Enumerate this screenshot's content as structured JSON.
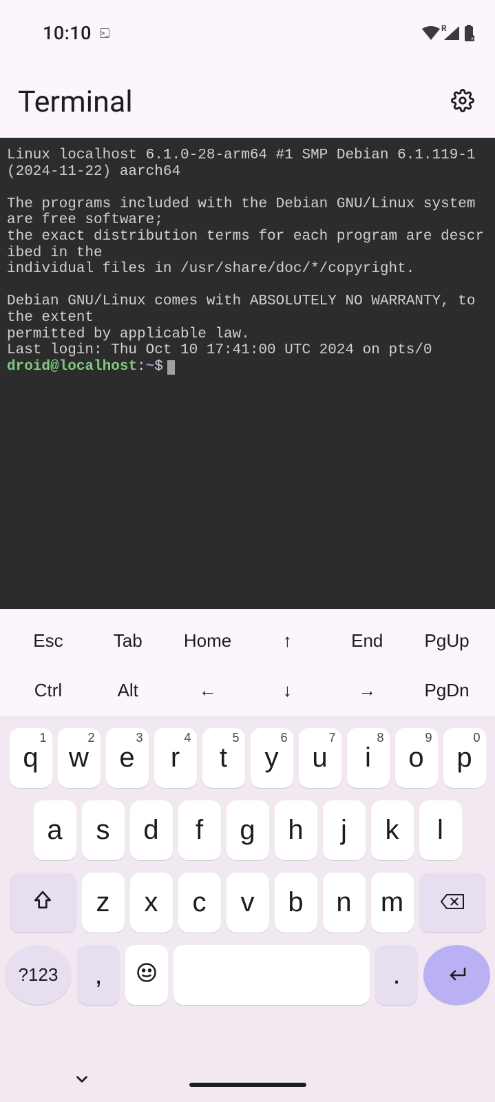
{
  "status": {
    "time": "10:10",
    "network_label": "R"
  },
  "header": {
    "title": "Terminal"
  },
  "terminal": {
    "motd_line1": "Linux localhost 6.1.0-28-arm64 #1 SMP Debian 6.1.119-1 (2024-11-22) aarch64",
    "blank1": "",
    "motd_line2": "The programs included with the Debian GNU/Linux system are free software;",
    "motd_line3": "the exact distribution terms for each program are described in the",
    "motd_line4": "individual files in /usr/share/doc/*/copyright.",
    "blank2": "",
    "motd_line5": "Debian GNU/Linux comes with ABSOLUTELY NO WARRANTY, to the extent",
    "motd_line6": "permitted by applicable law.",
    "last_login": "Last login: Thu Oct 10 17:41:00 UTC 2024 on pts/0",
    "prompt": {
      "user": "droid",
      "at": "@",
      "host": "localhost",
      "colon": ":",
      "path": "~",
      "sigil": "$"
    }
  },
  "special_keys": {
    "row1": [
      "Esc",
      "Tab",
      "Home",
      "↑",
      "End",
      "PgUp"
    ],
    "row2": [
      "Ctrl",
      "Alt",
      "←",
      "↓",
      "→",
      "PgDn"
    ]
  },
  "keyboard": {
    "row1": [
      {
        "k": "q",
        "n": "1"
      },
      {
        "k": "w",
        "n": "2"
      },
      {
        "k": "e",
        "n": "3"
      },
      {
        "k": "r",
        "n": "4"
      },
      {
        "k": "t",
        "n": "5"
      },
      {
        "k": "y",
        "n": "6"
      },
      {
        "k": "u",
        "n": "7"
      },
      {
        "k": "i",
        "n": "8"
      },
      {
        "k": "o",
        "n": "9"
      },
      {
        "k": "p",
        "n": "0"
      }
    ],
    "row2": [
      "a",
      "s",
      "d",
      "f",
      "g",
      "h",
      "j",
      "k",
      "l"
    ],
    "row3": [
      "z",
      "x",
      "c",
      "v",
      "b",
      "n",
      "m"
    ],
    "row4": {
      "numeric": "?123",
      "comma": ",",
      "period": "."
    }
  }
}
